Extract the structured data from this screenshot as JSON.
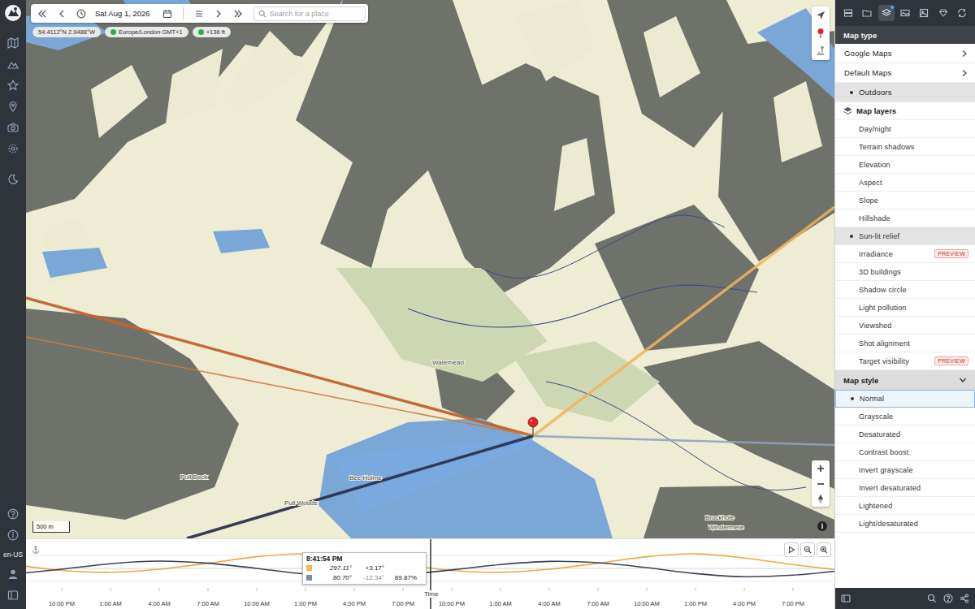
{
  "toolbar": {
    "date": "Sat Aug 1, 2026",
    "search_placeholder": "Search for a place"
  },
  "chips": [
    {
      "label": "54.4112°N 2.9488°W"
    },
    {
      "label": "Europe/London GMT+1",
      "color": "#27b24a"
    },
    {
      "label": "+136 ft",
      "color": "#27b24a"
    }
  ],
  "map": {
    "scale": "500 m",
    "labels": [
      "Waterhead",
      "Bee Holme",
      "Pull Woods",
      "Pull Beck",
      "Brockhole",
      "Windermere"
    ],
    "lines": [
      {
        "kind": "sunrise",
        "color": "#c2632c"
      },
      {
        "kind": "sunset",
        "color": "#cf7a3e"
      },
      {
        "kind": "sun",
        "color": "#f0b45a"
      },
      {
        "kind": "moonrise",
        "color": "#2c3350"
      },
      {
        "kind": "moon",
        "color": "#8da5be"
      }
    ]
  },
  "timeline": {
    "axis_title": "Time",
    "ticks": [
      "10:00 PM",
      "1:00 AM",
      "4:00 AM",
      "7:00 AM",
      "10:00 AM",
      "1:00 PM",
      "4:00 PM",
      "7:00 PM",
      "10:00 PM",
      "1:00 AM",
      "4:00 AM",
      "7:00 AM",
      "10:00 AM",
      "1:00 PM",
      "4:00 PM",
      "7:00 PM"
    ],
    "series": [
      {
        "color": "#f0a848",
        "values": [
          15,
          -8,
          -15,
          -3,
          20,
          45,
          56,
          40,
          15,
          -8,
          -15,
          -3,
          20,
          45,
          56,
          40,
          15,
          -8
        ]
      },
      {
        "color": "#3b4256",
        "values": [
          -22,
          -3,
          18,
          28,
          20,
          0,
          -22,
          -32,
          -24,
          -6,
          15,
          27,
          22,
          3,
          -20,
          -32,
          -26,
          -8
        ]
      }
    ],
    "tooltip": {
      "time": "8:41:54 PM",
      "rows": [
        {
          "color": "#f2b650",
          "azimuth": "297.11°",
          "elevation": "+3.17°",
          "elevation_dim": false
        },
        {
          "color": "#7d8ba0",
          "azimuth": "80.70°",
          "elevation": "-12.34°",
          "elevation_dim": true,
          "illumination": "89.87%"
        }
      ]
    }
  },
  "sidebar": {
    "language": "en-US"
  },
  "panel": {
    "tabs": [
      {
        "selected": false
      },
      {
        "selected": false
      },
      {
        "selected": true
      },
      {
        "selected": false
      },
      {
        "selected": false
      },
      {
        "selected": false
      },
      {
        "selected": false
      }
    ],
    "sections": [
      {
        "title": "Map type",
        "kind": "dark-header",
        "items": [
          {
            "label": "Google Maps",
            "kind": "submenu",
            "selected": false
          },
          {
            "label": "Default Maps",
            "kind": "submenu",
            "selected": false
          },
          {
            "label": "Outdoors",
            "kind": "option",
            "selected": true
          }
        ]
      },
      {
        "title": "Map layers",
        "kind": "icon-header",
        "items": [
          {
            "label": "Day/night",
            "kind": "option",
            "selected": false
          },
          {
            "label": "Terrain shadows",
            "kind": "option",
            "selected": false
          },
          {
            "label": "Elevation",
            "kind": "option",
            "selected": false
          },
          {
            "label": "Aspect",
            "kind": "option",
            "selected": false
          },
          {
            "label": "Slope",
            "kind": "option",
            "selected": false
          },
          {
            "label": "Hillshade",
            "kind": "option",
            "selected": false
          },
          {
            "label": "Sun-lit relief",
            "kind": "option",
            "selected": true
          },
          {
            "label": "Irradiance",
            "kind": "option",
            "selected": false,
            "badge": "PREVIEW"
          },
          {
            "label": "3D buildings",
            "kind": "option",
            "selected": false
          },
          {
            "label": "Shadow circle",
            "kind": "option",
            "selected": false
          },
          {
            "label": "Light pollution",
            "kind": "option",
            "selected": false
          },
          {
            "label": "Viewshed",
            "kind": "option",
            "selected": false
          },
          {
            "label": "Shot alignment",
            "kind": "option",
            "selected": false
          },
          {
            "label": "Target visibility",
            "kind": "option",
            "selected": false,
            "badge": "PREVIEW"
          }
        ]
      },
      {
        "title": "Map style",
        "kind": "collapsible",
        "expanded": true,
        "items": [
          {
            "label": "Normal",
            "kind": "option",
            "selected": true
          },
          {
            "label": "Grayscale",
            "kind": "option",
            "selected": false
          },
          {
            "label": "Desaturated",
            "kind": "option",
            "selected": false
          },
          {
            "label": "Contrast boost",
            "kind": "option",
            "selected": false
          },
          {
            "label": "Invert grayscale",
            "kind": "option",
            "selected": false
          },
          {
            "label": "Invert desaturated",
            "kind": "option",
            "selected": false
          },
          {
            "label": "Lightened",
            "kind": "option",
            "selected": false
          },
          {
            "label": "Light/desaturated",
            "kind": "option",
            "selected": false
          }
        ]
      }
    ]
  }
}
